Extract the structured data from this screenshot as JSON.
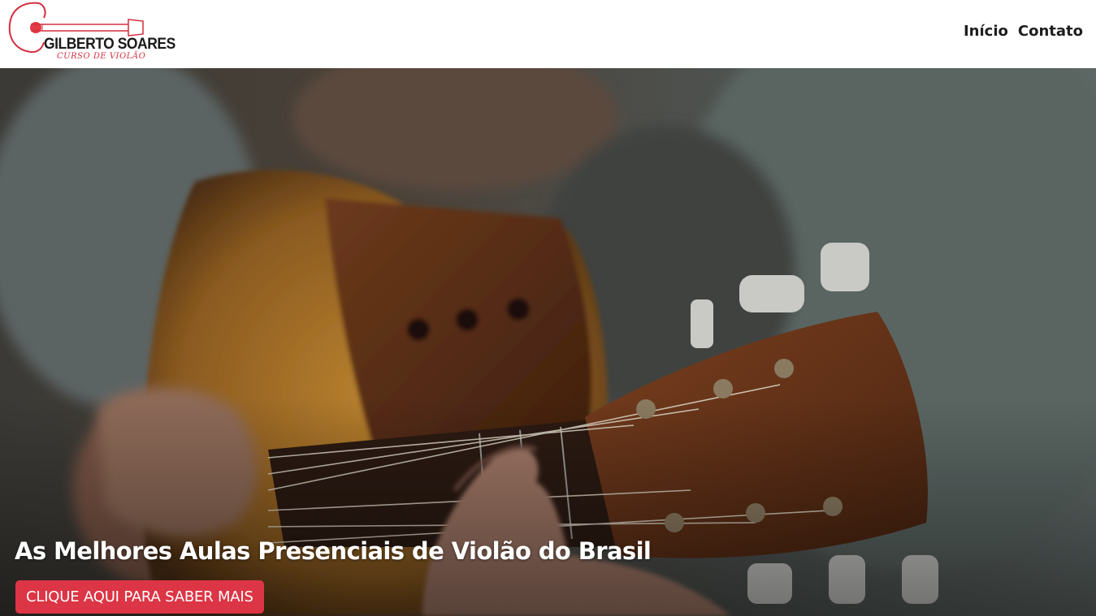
{
  "brand": {
    "name": "GILBERTO SOARES",
    "tagline": "CURSO DE VIOLÃO",
    "logo_icon": "guitar-icon",
    "accent_color": "#dc3545"
  },
  "nav": {
    "items": [
      {
        "label": "Início"
      },
      {
        "label": "Contato"
      }
    ]
  },
  "hero": {
    "title": "As Melhores Aulas Presenciais de Violão do Brasil",
    "cta_label": "CLIQUE AQUI PARA SABER MAIS"
  }
}
